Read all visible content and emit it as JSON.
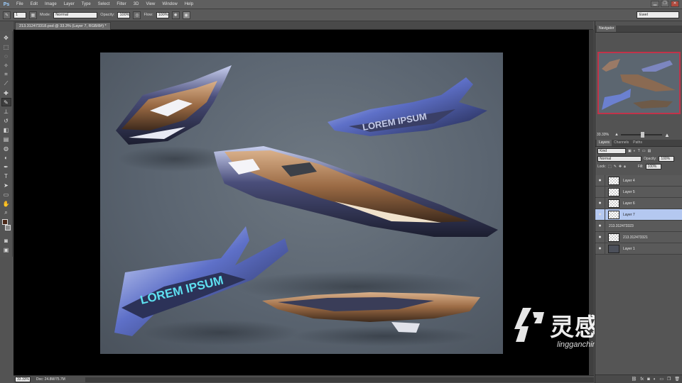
{
  "app": {
    "logo": "Ps"
  },
  "menu": [
    "File",
    "Edit",
    "Image",
    "Layer",
    "Type",
    "Select",
    "Filter",
    "3D",
    "View",
    "Window",
    "Help"
  ],
  "window_controls": {
    "minimize": "▁",
    "restore": "❐",
    "close": "✕"
  },
  "options": {
    "brush_size": "1",
    "mode_label": "Mode:",
    "mode_value": "Normal",
    "opacity_label": "Opacity:",
    "opacity_value": "100%",
    "flow_label": "Flow:",
    "flow_value": "100%",
    "workspace": "Ewel"
  },
  "document": {
    "tab_title": "213.312473318.psd @ 33.3% (Layer 7, RGB/8#) *",
    "zoom": "33.33%",
    "doc_info": "Doc: 24.8M/75.7M"
  },
  "art": {
    "text_1": "LOREM IPSUM",
    "text_2": "LOREM IPSUM"
  },
  "navigator": {
    "tab": "Navigator",
    "zoom": "33.33%"
  },
  "layers_panel": {
    "tabs": [
      "Layers",
      "Channels",
      "Paths"
    ],
    "kind": "Kind",
    "blend": "Normal",
    "opacity_label": "Opacity:",
    "opacity_value": "100%",
    "lock_label": "Lock:",
    "fill_label": "Fill:",
    "fill_value": "100%",
    "layers": [
      {
        "name": "Layer 4",
        "visible": true
      },
      {
        "name": "Layer 5",
        "visible": false
      },
      {
        "name": "Layer 6",
        "visible": true
      },
      {
        "name": "Layer 7",
        "visible": true,
        "selected": true
      },
      {
        "name": "213.312473323",
        "visible": true
      },
      {
        "name": "213.312473321",
        "visible": true
      },
      {
        "name": "Layer 1",
        "visible": true
      }
    ],
    "footer_icons": [
      "link-icon",
      "fx-icon",
      "mask-icon",
      "adjustment-icon",
      "folder-icon",
      "new-layer-icon",
      "trash-icon"
    ]
  },
  "watermark": {
    "cn": "灵感中国",
    "url": "lingganchina.com"
  },
  "colors": {
    "selected_layer": "#b4c8f0",
    "nav_frame": "#c2334a",
    "canvas_bg": "#5a6470"
  }
}
